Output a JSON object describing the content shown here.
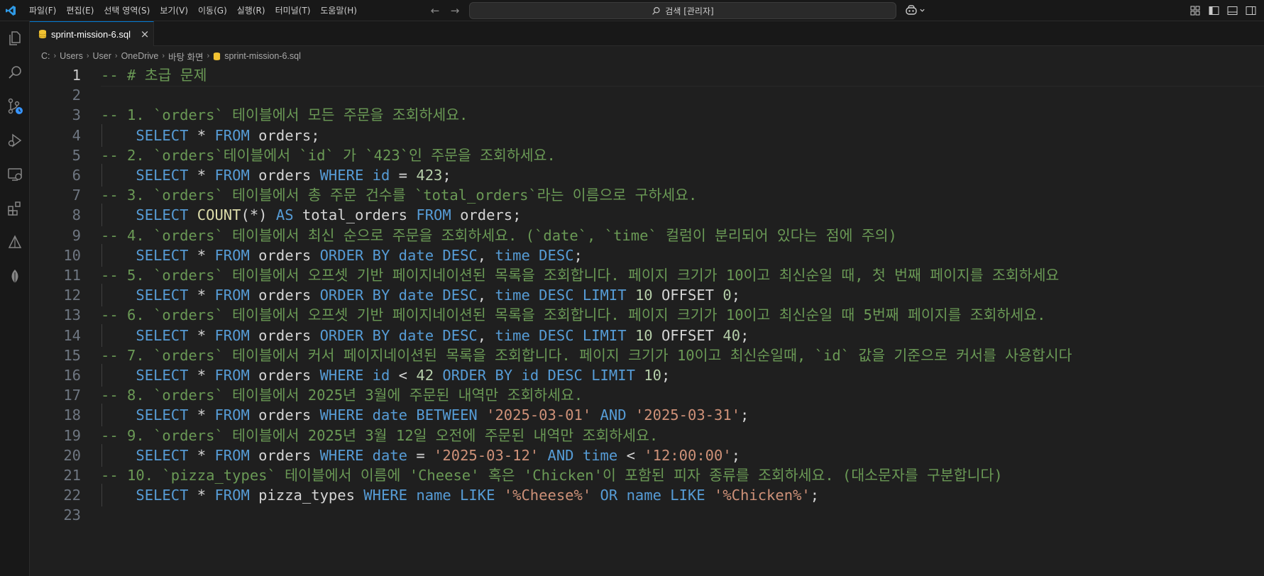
{
  "titlebar": {
    "menu": [
      "파일(F)",
      "편집(E)",
      "선택 영역(S)",
      "보기(V)",
      "이동(G)",
      "실행(R)",
      "터미널(T)",
      "도움말(H)"
    ],
    "search_label": "검색 [관리자]"
  },
  "tab": {
    "label": "sprint-mission-6.sql",
    "close": "×"
  },
  "breadcrumb": [
    "C:",
    "Users",
    "User",
    "OneDrive",
    "바탕 화면",
    "sprint-mission-6.sql"
  ],
  "icons": {
    "activity": [
      "explorer-icon",
      "search-icon",
      "source-control-icon",
      "run-debug-icon",
      "remote-explorer-icon",
      "extensions-icon",
      "database-icon",
      "mongodb-leaf-icon"
    ],
    "layout": [
      "customize-layout-icon",
      "toggle-primary-sidebar-icon",
      "toggle-panel-icon",
      "toggle-secondary-sidebar-icon"
    ]
  },
  "colors": {
    "comment": "#6a9955",
    "keyword": "#569cd6",
    "string": "#ce9178",
    "number": "#b5cea8",
    "function": "#dcdcaa",
    "accent": "#0078d4"
  },
  "editor": {
    "active_line": 1,
    "lines": [
      {
        "n": "1",
        "indent": false,
        "tokens": [
          {
            "t": "c",
            "v": "-- # 초급 문제"
          }
        ]
      },
      {
        "n": "2",
        "indent": false,
        "tokens": []
      },
      {
        "n": "3",
        "indent": false,
        "tokens": [
          {
            "t": "c",
            "v": "-- 1. `orders` 테이블에서 모든 주문을 조회하세요."
          }
        ]
      },
      {
        "n": "4",
        "indent": true,
        "tokens": [
          {
            "t": "k",
            "v": "SELECT"
          },
          {
            "t": "p",
            "v": " * "
          },
          {
            "t": "k",
            "v": "FROM"
          },
          {
            "t": "i",
            "v": " orders;"
          }
        ]
      },
      {
        "n": "5",
        "indent": false,
        "tokens": [
          {
            "t": "c",
            "v": "-- 2. `orders`테이블에서 `id` 가 `423`인 주문을 조회하세요."
          }
        ]
      },
      {
        "n": "6",
        "indent": true,
        "tokens": [
          {
            "t": "k",
            "v": "SELECT"
          },
          {
            "t": "p",
            "v": " * "
          },
          {
            "t": "k",
            "v": "FROM"
          },
          {
            "t": "i",
            "v": " orders "
          },
          {
            "t": "k",
            "v": "WHERE"
          },
          {
            "t": "k",
            "v": " id"
          },
          {
            "t": "p",
            "v": " = "
          },
          {
            "t": "n",
            "v": "423"
          },
          {
            "t": "p",
            "v": ";"
          }
        ]
      },
      {
        "n": "7",
        "indent": false,
        "tokens": [
          {
            "t": "c",
            "v": "-- 3. `orders` 테이블에서 총 주문 건수를 `total_orders`라는 이름으로 구하세요."
          }
        ]
      },
      {
        "n": "8",
        "indent": true,
        "tokens": [
          {
            "t": "k",
            "v": "SELECT"
          },
          {
            "t": "f",
            "v": " COUNT"
          },
          {
            "t": "p",
            "v": "(*) "
          },
          {
            "t": "k",
            "v": "AS"
          },
          {
            "t": "i",
            "v": " total_orders "
          },
          {
            "t": "k",
            "v": "FROM"
          },
          {
            "t": "i",
            "v": " orders;"
          }
        ]
      },
      {
        "n": "9",
        "indent": false,
        "tokens": [
          {
            "t": "c",
            "v": "-- 4. `orders` 테이블에서 최신 순으로 주문을 조회하세요. (`date`, `time` 컬럼이 분리되어 있다는 점에 주의)"
          }
        ]
      },
      {
        "n": "10",
        "indent": true,
        "tokens": [
          {
            "t": "k",
            "v": "SELECT"
          },
          {
            "t": "p",
            "v": " * "
          },
          {
            "t": "k",
            "v": "FROM"
          },
          {
            "t": "i",
            "v": " orders "
          },
          {
            "t": "k",
            "v": "ORDER BY date DESC"
          },
          {
            "t": "p",
            "v": ", "
          },
          {
            "t": "k",
            "v": "time DESC"
          },
          {
            "t": "p",
            "v": ";"
          }
        ]
      },
      {
        "n": "11",
        "indent": false,
        "tokens": [
          {
            "t": "c",
            "v": "-- 5. `orders` 테이블에서 오프셋 기반 페이지네이션된 목록을 조회합니다. 페이지 크기가 10이고 최신순일 때, 첫 번째 페이지를 조회하세요"
          }
        ]
      },
      {
        "n": "12",
        "indent": true,
        "tokens": [
          {
            "t": "k",
            "v": "SELECT"
          },
          {
            "t": "p",
            "v": " * "
          },
          {
            "t": "k",
            "v": "FROM"
          },
          {
            "t": "i",
            "v": " orders "
          },
          {
            "t": "k",
            "v": "ORDER BY date DESC"
          },
          {
            "t": "p",
            "v": ", "
          },
          {
            "t": "k",
            "v": "time DESC LIMIT"
          },
          {
            "t": "p",
            "v": " "
          },
          {
            "t": "n",
            "v": "10"
          },
          {
            "t": "i",
            "v": " OFFSET "
          },
          {
            "t": "n",
            "v": "0"
          },
          {
            "t": "p",
            "v": ";"
          }
        ]
      },
      {
        "n": "13",
        "indent": false,
        "tokens": [
          {
            "t": "c",
            "v": "-- 6. `orders` 테이블에서 오프셋 기반 페이지네이션된 목록을 조회합니다. 페이지 크기가 10이고 최신순일 때 5번째 페이지를 조회하세요."
          }
        ]
      },
      {
        "n": "14",
        "indent": true,
        "tokens": [
          {
            "t": "k",
            "v": "SELECT"
          },
          {
            "t": "p",
            "v": " * "
          },
          {
            "t": "k",
            "v": "FROM"
          },
          {
            "t": "i",
            "v": " orders "
          },
          {
            "t": "k",
            "v": "ORDER BY date DESC"
          },
          {
            "t": "p",
            "v": ", "
          },
          {
            "t": "k",
            "v": "time DESC LIMIT"
          },
          {
            "t": "p",
            "v": " "
          },
          {
            "t": "n",
            "v": "10"
          },
          {
            "t": "i",
            "v": " OFFSET "
          },
          {
            "t": "n",
            "v": "40"
          },
          {
            "t": "p",
            "v": ";"
          }
        ]
      },
      {
        "n": "15",
        "indent": false,
        "tokens": [
          {
            "t": "c",
            "v": "-- 7. `orders` 테이블에서 커서 페이지네이션된 목록을 조회합니다. 페이지 크기가 10이고 최신순일때, `id` 값을 기준으로 커서를 사용합시다"
          }
        ]
      },
      {
        "n": "16",
        "indent": true,
        "tokens": [
          {
            "t": "k",
            "v": "SELECT"
          },
          {
            "t": "p",
            "v": " * "
          },
          {
            "t": "k",
            "v": "FROM"
          },
          {
            "t": "i",
            "v": " orders "
          },
          {
            "t": "k",
            "v": "WHERE"
          },
          {
            "t": "k",
            "v": " id"
          },
          {
            "t": "p",
            "v": " < "
          },
          {
            "t": "n",
            "v": "42"
          },
          {
            "t": "k",
            "v": " ORDER BY id DESC LIMIT"
          },
          {
            "t": "p",
            "v": " "
          },
          {
            "t": "n",
            "v": "10"
          },
          {
            "t": "p",
            "v": ";"
          }
        ]
      },
      {
        "n": "17",
        "indent": false,
        "tokens": [
          {
            "t": "c",
            "v": "-- 8. `orders` 테이블에서 2025년 3월에 주문된 내역만 조회하세요."
          }
        ]
      },
      {
        "n": "18",
        "indent": true,
        "tokens": [
          {
            "t": "k",
            "v": "SELECT"
          },
          {
            "t": "p",
            "v": " * "
          },
          {
            "t": "k",
            "v": "FROM"
          },
          {
            "t": "i",
            "v": " orders "
          },
          {
            "t": "k",
            "v": "WHERE date BETWEEN"
          },
          {
            "t": "p",
            "v": " "
          },
          {
            "t": "s",
            "v": "'2025-03-01'"
          },
          {
            "t": "k",
            "v": " AND"
          },
          {
            "t": "p",
            "v": " "
          },
          {
            "t": "s",
            "v": "'2025-03-31'"
          },
          {
            "t": "p",
            "v": ";"
          }
        ]
      },
      {
        "n": "19",
        "indent": false,
        "tokens": [
          {
            "t": "c",
            "v": "-- 9. `orders` 테이블에서 2025년 3월 12일 오전에 주문된 내역만 조회하세요."
          }
        ]
      },
      {
        "n": "20",
        "indent": true,
        "tokens": [
          {
            "t": "k",
            "v": "SELECT"
          },
          {
            "t": "p",
            "v": " * "
          },
          {
            "t": "k",
            "v": "FROM"
          },
          {
            "t": "i",
            "v": " orders "
          },
          {
            "t": "k",
            "v": "WHERE date"
          },
          {
            "t": "p",
            "v": " = "
          },
          {
            "t": "s",
            "v": "'2025-03-12'"
          },
          {
            "t": "k",
            "v": " AND time"
          },
          {
            "t": "p",
            "v": " < "
          },
          {
            "t": "s",
            "v": "'12:00:00'"
          },
          {
            "t": "p",
            "v": ";"
          }
        ]
      },
      {
        "n": "21",
        "indent": false,
        "tokens": [
          {
            "t": "c",
            "v": "-- 10. `pizza_types` 테이블에서 이름에 'Cheese' 혹은 'Chicken'이 포함된 피자 종류를 조회하세요. (대소문자를 구분합니다)"
          }
        ]
      },
      {
        "n": "22",
        "indent": true,
        "tokens": [
          {
            "t": "k",
            "v": "SELECT"
          },
          {
            "t": "p",
            "v": " * "
          },
          {
            "t": "k",
            "v": "FROM"
          },
          {
            "t": "i",
            "v": " pizza_types "
          },
          {
            "t": "k",
            "v": "WHERE name LIKE"
          },
          {
            "t": "p",
            "v": " "
          },
          {
            "t": "s",
            "v": "'%Cheese%'"
          },
          {
            "t": "k",
            "v": " OR name LIKE"
          },
          {
            "t": "p",
            "v": " "
          },
          {
            "t": "s",
            "v": "'%Chicken%'"
          },
          {
            "t": "p",
            "v": ";"
          }
        ]
      },
      {
        "n": "23",
        "indent": false,
        "tokens": []
      }
    ]
  }
}
